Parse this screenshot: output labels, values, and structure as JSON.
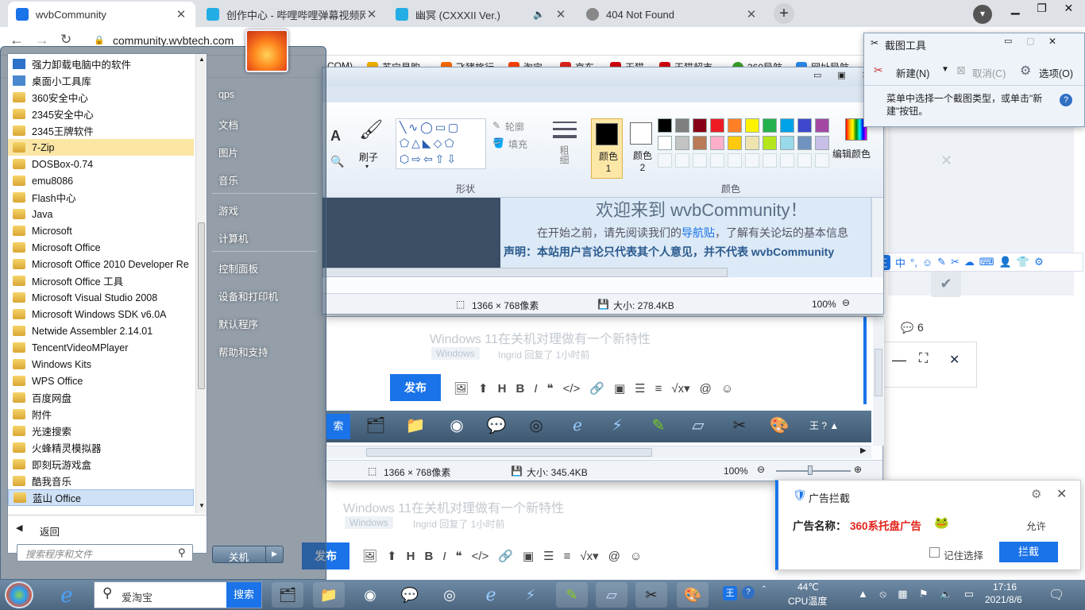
{
  "browser": {
    "tabs": [
      {
        "title": "wvbCommunity",
        "active": true
      },
      {
        "title": "创作中心 - 哔哩哔哩弹幕视频网",
        "active": false
      },
      {
        "title": "幽冥 (CXXXII Ver.)",
        "active": false
      },
      {
        "title": "404 Not Found",
        "active": false
      }
    ],
    "url": "community.wvbtech.com",
    "bookmarks": [
      "COM)",
      "苏宁易购",
      "飞猪旅行",
      "淘宝",
      "京东",
      "天猫",
      "天猫超市",
      "360导航",
      "网址导航"
    ]
  },
  "page": {
    "welcome": "欢迎来到 wvbCommunity！",
    "intro_prefix": "在开始之前，请先阅读我们的",
    "intro_link": "导航贴",
    "intro_suffix": "，了解有关论坛的基本信息",
    "notice": "声明：本站用户言论只代表其个人意见，并不代表 wvbCommunity",
    "post_title": "Windows 11在关机对理做有一个新特性",
    "post_tag": "Windows",
    "post_meta": "Ingrid 回复了 1小时前",
    "comment_count": "6",
    "publish_label": "发布",
    "comment_icon": "comment-icon"
  },
  "paint_big": {
    "group_shapes": "形状",
    "group_colors": "颜色",
    "outline": "轮廓",
    "fill": "填充",
    "brush": "刷子",
    "thickness": "粗细",
    "color1": "颜色 1",
    "color2": "颜色 2",
    "edit_colors": "编辑颜色",
    "dimensions": "1366 × 768像素",
    "size": "大小: 278.4KB",
    "zoom": "100%"
  },
  "paint_small": {
    "dimensions": "1366 × 768像素",
    "size": "大小: 345.4KB",
    "zoom": "100%"
  },
  "snipping_tool": {
    "title": "截图工具",
    "new": "新建(N)",
    "cancel": "取消(C)",
    "options": "选项(O)",
    "hint": "菜单中选择一个截图类型，或单击\"新建\"按钮。"
  },
  "start_menu": {
    "programs": [
      "强力卸载电脑中的软件",
      "桌面小工具库",
      "360安全中心",
      "2345安全中心",
      "2345王牌软件",
      "7-Zip",
      "DOSBox-0.74",
      "emu8086",
      "Flash中心",
      "Java",
      "Microsoft",
      "Microsoft Office",
      "Microsoft Office 2010 Developer Re",
      "Microsoft Office 工具",
      "Microsoft Visual Studio 2008",
      "Microsoft Windows SDK v6.0A",
      "Netwide Assembler 2.14.01",
      "TencentVideoMPlayer",
      "Windows Kits",
      "WPS Office",
      "百度网盘",
      "附件",
      "光速搜索",
      "火蜂精灵模拟器",
      "即刻玩游戏盒",
      "酷我音乐",
      "蓝山 Office"
    ],
    "back": "返回",
    "search_placeholder": "搜索程序和文件",
    "right_links": [
      "qps",
      "文档",
      "图片",
      "音乐",
      "游戏",
      "计算机",
      "控制面板",
      "设备和打印机",
      "默认程序",
      "帮助和支持"
    ],
    "shutdown": "关机"
  },
  "ad_block": {
    "title": "广告拦截",
    "label": "广告名称：",
    "name": "360系托盘广告",
    "allow": "允许",
    "remember": "记住选择",
    "block": "拦截"
  },
  "taskbar": {
    "search_placeholder": "爱淘宝",
    "search_btn": "搜索",
    "temp": "44℃",
    "temp_label": "CPU温度",
    "time": "17:16",
    "date": "2021/8/6",
    "ime": "王"
  }
}
